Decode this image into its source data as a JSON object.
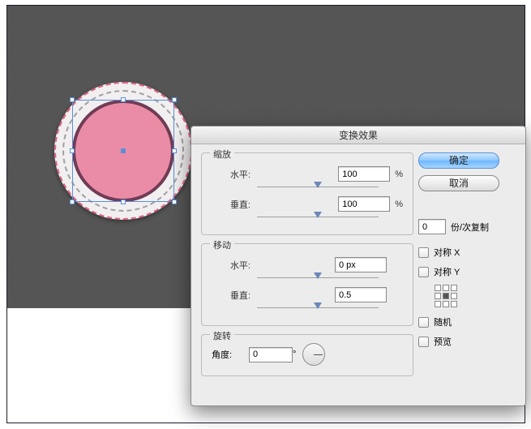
{
  "dialog": {
    "title": "变换效果",
    "buttons": {
      "ok": "确定",
      "cancel": "取消"
    },
    "scale": {
      "legend": "缩放",
      "h_label": "水平:",
      "h_value": "100",
      "h_unit": "%",
      "v_label": "垂直:",
      "v_value": "100",
      "v_unit": "%"
    },
    "move": {
      "legend": "移动",
      "h_label": "水平:",
      "h_value": "0 px",
      "v_label": "垂直:",
      "v_value": "0.5"
    },
    "rotate": {
      "legend": "旋转",
      "angle_label": "角度:",
      "angle_value": "0",
      "angle_unit": "°"
    },
    "copies": {
      "value": "0",
      "label": "份/次复制"
    },
    "options": {
      "reflect_x": "对称 X",
      "reflect_y": "对称 Y",
      "random": "随机",
      "preview": "预览"
    }
  }
}
